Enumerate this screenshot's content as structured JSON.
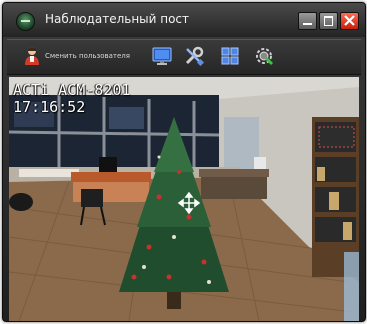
{
  "window": {
    "title": "Наблюдательный пост"
  },
  "toolbar": {
    "change_user_label": "Сменить пользователя",
    "icons": [
      "user-icon",
      "monitor-icon",
      "tools-icon",
      "grid-layout-icon",
      "camera-settings-icon"
    ]
  },
  "video": {
    "osd_line1": "ACTi ACM-8201",
    "osd_line2": "17:16:52"
  },
  "colors": {
    "close_button": "#d6301a",
    "titlebar": "#2e2e2e",
    "icon_accent": "#6aa8ff"
  }
}
